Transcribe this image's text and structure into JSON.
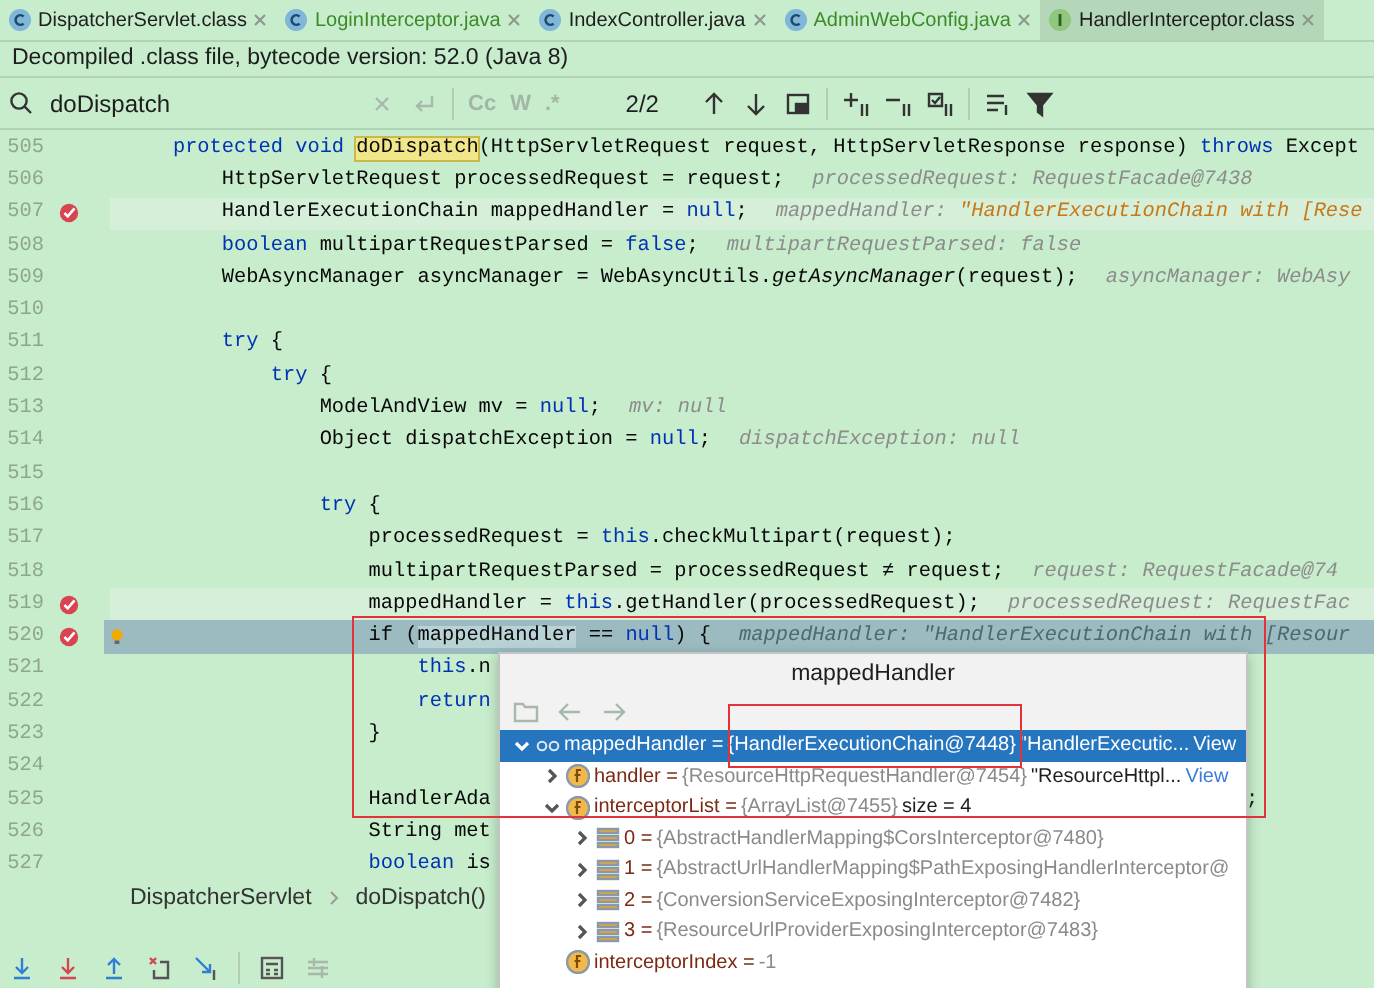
{
  "tabs": [
    {
      "label": "DispatcherServlet.class",
      "kind": "class",
      "modified": false,
      "selected": false
    },
    {
      "label": "LoginInterceptor.java",
      "kind": "class",
      "modified": true,
      "selected": false
    },
    {
      "label": "IndexController.java",
      "kind": "class",
      "modified": false,
      "selected": false
    },
    {
      "label": "AdminWebConfig.java",
      "kind": "class",
      "modified": true,
      "selected": false
    },
    {
      "label": "HandlerInterceptor.class",
      "kind": "interface",
      "modified": false,
      "selected": true
    }
  ],
  "notice": "Decompiled .class file, bytecode version: 52.0 (Java 8)",
  "search": {
    "value": "doDispatch",
    "options": [
      "Cc",
      "W",
      ".*"
    ],
    "count": "2/2"
  },
  "lines": [
    {
      "number": "505",
      "breakpoint": false,
      "intention": false,
      "current": false,
      "code": [
        {
          "text": "    protected void ",
          "kind": "kw"
        },
        {
          "text": "doDispatch",
          "kind": "match"
        },
        {
          "text": "(HttpServletRequest request, HttpServletResponse response) ",
          "kind": "plain"
        },
        {
          "text": "throws",
          "kind": "kw"
        },
        {
          "text": " Except",
          "kind": "plain"
        }
      ]
    },
    {
      "number": "506",
      "breakpoint": false,
      "intention": false,
      "current": false,
      "code": [
        {
          "text": "        HttpServletRequest processedRequest = request;",
          "kind": "plain"
        }
      ],
      "hint": {
        "label": "processedRequest:",
        "value": "RequestFacade@7438",
        "changed": false
      }
    },
    {
      "number": "507",
      "breakpoint": true,
      "intention": false,
      "current": false,
      "code": [
        {
          "text": "        HandlerExecutionChain mappedHandler = ",
          "kind": "plain"
        },
        {
          "text": "null",
          "kind": "kw"
        },
        {
          "text": ";",
          "kind": "plain"
        }
      ],
      "hint": {
        "label": "mappedHandler:",
        "value": "\"HandlerExecutionChain with [Rese",
        "changed": true
      }
    },
    {
      "number": "508",
      "breakpoint": false,
      "intention": false,
      "current": false,
      "code": [
        {
          "text": "        boolean",
          "kind": "kw"
        },
        {
          "text": " multipartRequestParsed = ",
          "kind": "plain"
        },
        {
          "text": "false",
          "kind": "kw"
        },
        {
          "text": ";",
          "kind": "plain"
        }
      ],
      "hint": {
        "label": "multipartRequestParsed:",
        "value": "false",
        "changed": false
      }
    },
    {
      "number": "509",
      "breakpoint": false,
      "intention": false,
      "current": false,
      "code": [
        {
          "text": "        WebAsyncManager asyncManager = WebAsyncUtils.",
          "kind": "plain"
        },
        {
          "text": "getAsyncManager",
          "kind": "italic"
        },
        {
          "text": "(request);",
          "kind": "plain"
        }
      ],
      "hint": {
        "label": "asyncManager:",
        "value": "WebAsy",
        "changed": false
      }
    },
    {
      "number": "510",
      "breakpoint": false,
      "intention": false,
      "current": false
    },
    {
      "number": "511",
      "breakpoint": false,
      "intention": false,
      "current": false,
      "code": [
        {
          "text": "        try",
          "kind": "kw"
        },
        {
          "text": " {",
          "kind": "plain"
        }
      ]
    },
    {
      "number": "512",
      "breakpoint": false,
      "intention": false,
      "current": false,
      "code": [
        {
          "text": "            try",
          "kind": "kw"
        },
        {
          "text": " {",
          "kind": "plain"
        }
      ]
    },
    {
      "number": "513",
      "breakpoint": false,
      "intention": false,
      "current": false,
      "code": [
        {
          "text": "                ModelAndView mv = ",
          "kind": "plain"
        },
        {
          "text": "null",
          "kind": "kw"
        },
        {
          "text": ";",
          "kind": "plain"
        }
      ],
      "hint": {
        "label": "mv:",
        "value": "null",
        "changed": false
      }
    },
    {
      "number": "514",
      "breakpoint": false,
      "intention": false,
      "current": false,
      "code": [
        {
          "text": "                Object dispatchException = ",
          "kind": "plain"
        },
        {
          "text": "null",
          "kind": "kw"
        },
        {
          "text": ";",
          "kind": "plain"
        }
      ],
      "hint": {
        "label": "dispatchException:",
        "value": "null",
        "changed": false
      }
    },
    {
      "number": "515",
      "breakpoint": false,
      "intention": false,
      "current": false
    },
    {
      "number": "516",
      "breakpoint": false,
      "intention": false,
      "current": false,
      "code": [
        {
          "text": "                try",
          "kind": "kw"
        },
        {
          "text": " {",
          "kind": "plain"
        }
      ]
    },
    {
      "number": "517",
      "breakpoint": false,
      "intention": false,
      "current": false,
      "code": [
        {
          "text": "                    processedRequest = ",
          "kind": "plain"
        },
        {
          "text": "this",
          "kind": "kw"
        },
        {
          "text": ".checkMultipart(request);",
          "kind": "plain"
        }
      ]
    },
    {
      "number": "518",
      "breakpoint": false,
      "intention": false,
      "current": false,
      "code": [
        {
          "text": "                    multipartRequestParsed = processedRequest ≠ request;",
          "kind": "plain"
        }
      ],
      "hint": {
        "label": "request:",
        "value": "RequestFacade@74",
        "changed": false
      }
    },
    {
      "number": "519",
      "breakpoint": true,
      "intention": false,
      "current": false,
      "code": [
        {
          "text": "                    mappedHandler = ",
          "kind": "plain"
        },
        {
          "text": "this",
          "kind": "kw"
        },
        {
          "text": ".getHandler(processedRequest);",
          "kind": "plain"
        }
      ],
      "hint": {
        "label": "processedRequest:",
        "value": "RequestFac",
        "changed": false
      }
    },
    {
      "number": "520",
      "breakpoint": true,
      "intention": true,
      "current": true,
      "code": [
        {
          "text": "                    if (",
          "kind": "plain"
        },
        {
          "text": "mappedHandler",
          "kind": "usage"
        },
        {
          "text": " == ",
          "kind": "plain"
        },
        {
          "text": "null",
          "kind": "kw"
        },
        {
          "text": ") {",
          "kind": "plain"
        }
      ],
      "hint": {
        "label": "mappedHandler:",
        "value": "\"HandlerExecutionChain with [Resour",
        "changed": false
      }
    },
    {
      "number": "521",
      "breakpoint": false,
      "intention": false,
      "current": false,
      "code": [
        {
          "text": "                        this",
          "kind": "kw"
        },
        {
          "text": ".n",
          "kind": "plain"
        }
      ]
    },
    {
      "number": "522",
      "breakpoint": false,
      "intention": false,
      "current": false,
      "code": [
        {
          "text": "                        return",
          "kind": "kw"
        }
      ]
    },
    {
      "number": "523",
      "breakpoint": false,
      "intention": false,
      "current": false,
      "code": [
        {
          "text": "                    }",
          "kind": "plain"
        }
      ]
    },
    {
      "number": "524",
      "breakpoint": false,
      "intention": false,
      "current": false
    },
    {
      "number": "525",
      "breakpoint": false,
      "intention": false,
      "current": false,
      "code": [
        {
          "text": "                    HandlerAda",
          "kind": "plain"
        }
      ],
      "tail": ";"
    },
    {
      "number": "526",
      "breakpoint": false,
      "intention": false,
      "current": false,
      "code": [
        {
          "text": "                    String met",
          "kind": "plain"
        }
      ]
    },
    {
      "number": "527",
      "breakpoint": false,
      "intention": false,
      "current": false,
      "code": [
        {
          "text": "                    boolean",
          "kind": "kw"
        },
        {
          "text": " is",
          "kind": "plain"
        }
      ]
    }
  ],
  "breadcrumb": [
    "DispatcherServlet",
    "doDispatch()"
  ],
  "popup": {
    "title": "mappedHandler",
    "tree": [
      {
        "kind": "watch",
        "name": "mappedHandler =",
        "value": "{HandlerExecutionChain@7448}",
        "extra": "\"HandlerExecutic...",
        "link": "View",
        "leaf": false,
        "expanded": true,
        "selected": true,
        "children": [
          {
            "kind": "field",
            "name": "handler =",
            "value": "{ResourceHttpRequestHandler@7454}",
            "extra": "\"ResourceHttpl...",
            "link": "View",
            "leaf": false,
            "expanded": false,
            "selected": false
          },
          {
            "kind": "field",
            "name": "interceptorList =",
            "value": "{ArrayList@7455}",
            "extra": "size = 4",
            "leaf": false,
            "expanded": true,
            "selected": false,
            "children": [
              {
                "kind": "element",
                "name": "0 =",
                "value": "{AbstractHandlerMapping$CorsInterceptor@7480}",
                "leaf": false,
                "expanded": false,
                "selected": false
              },
              {
                "kind": "element",
                "name": "1 =",
                "value": "{AbstractUrlHandlerMapping$PathExposingHandlerInterceptor@",
                "leaf": false,
                "expanded": false,
                "selected": false
              },
              {
                "kind": "element",
                "name": "2 =",
                "value": "{ConversionServiceExposingInterceptor@7482}",
                "leaf": false,
                "expanded": false,
                "selected": false
              },
              {
                "kind": "element",
                "name": "3 =",
                "value": "{ResourceUrlProviderExposingInterceptor@7483}",
                "leaf": false,
                "expanded": false,
                "selected": false
              }
            ]
          },
          {
            "kind": "field",
            "name": "interceptorIndex =",
            "value": "-1",
            "leaf": true,
            "selected": false
          }
        ]
      }
    ]
  }
}
